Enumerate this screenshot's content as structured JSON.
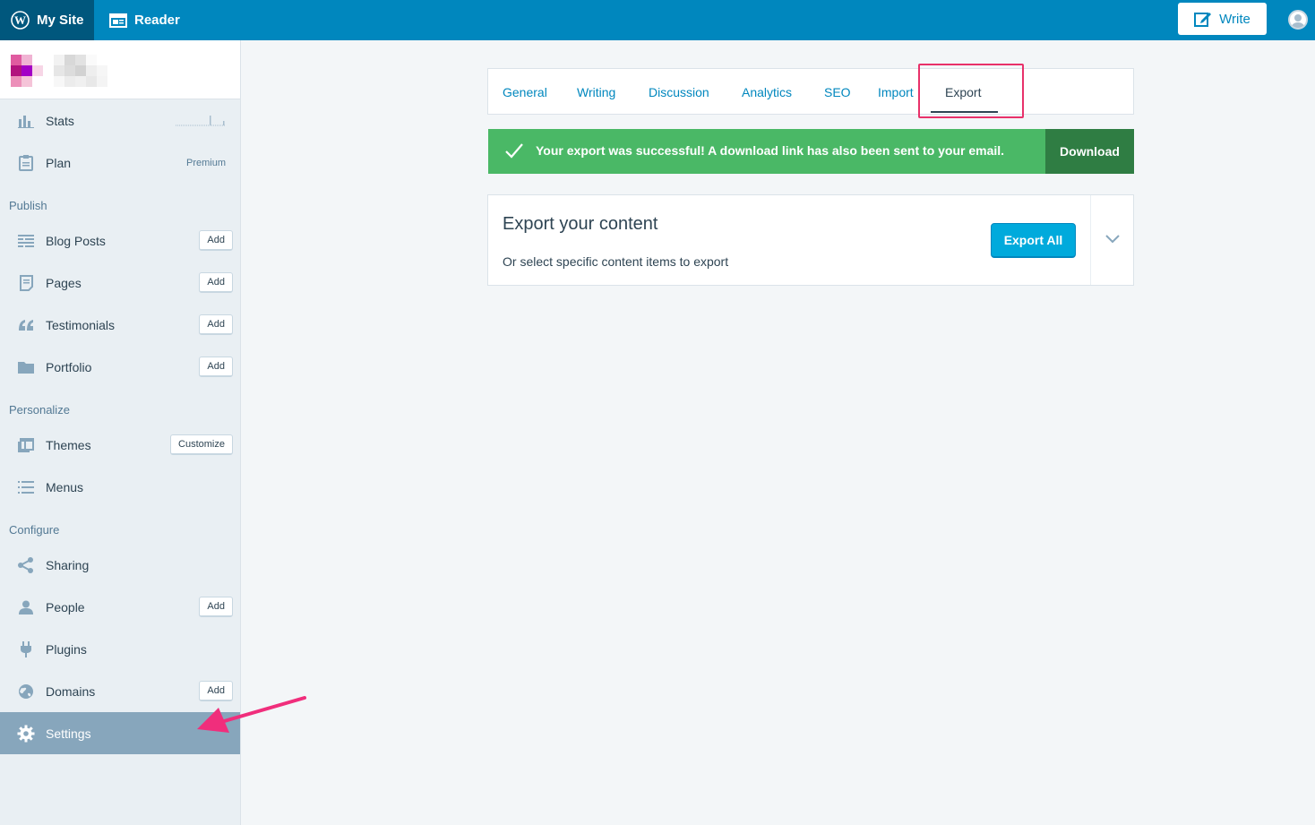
{
  "masterbar": {
    "my_site": "My Site",
    "reader": "Reader",
    "write": "Write"
  },
  "sidebar": {
    "stats": "Stats",
    "plan": "Plan",
    "plan_meta": "Premium",
    "headings": {
      "publish": "Publish",
      "personalize": "Personalize",
      "configure": "Configure"
    },
    "publish": [
      {
        "label": "Blog Posts",
        "action": "Add"
      },
      {
        "label": "Pages",
        "action": "Add"
      },
      {
        "label": "Testimonials",
        "action": "Add"
      },
      {
        "label": "Portfolio",
        "action": "Add"
      }
    ],
    "personalize": [
      {
        "label": "Themes",
        "action": "Customize"
      },
      {
        "label": "Menus"
      }
    ],
    "configure": [
      {
        "label": "Sharing"
      },
      {
        "label": "People",
        "action": "Add"
      },
      {
        "label": "Plugins"
      },
      {
        "label": "Domains",
        "action": "Add"
      },
      {
        "label": "Settings"
      }
    ]
  },
  "tabs": [
    "General",
    "Writing",
    "Discussion",
    "Analytics",
    "SEO",
    "Import",
    "Export"
  ],
  "active_tab": "Export",
  "notice": {
    "message": "Your export was successful! A download link has also been sent to your email.",
    "download": "Download"
  },
  "export": {
    "title": "Export your content",
    "subtitle": "Or select specific content items to export",
    "button": "Export All"
  },
  "colors": {
    "masterbar": "#0087be",
    "success": "#4ab866",
    "success_dark": "#2f7d43",
    "primary_button": "#00aadc",
    "highlight": "#e8316a",
    "selected_item": "#87a6bc"
  }
}
